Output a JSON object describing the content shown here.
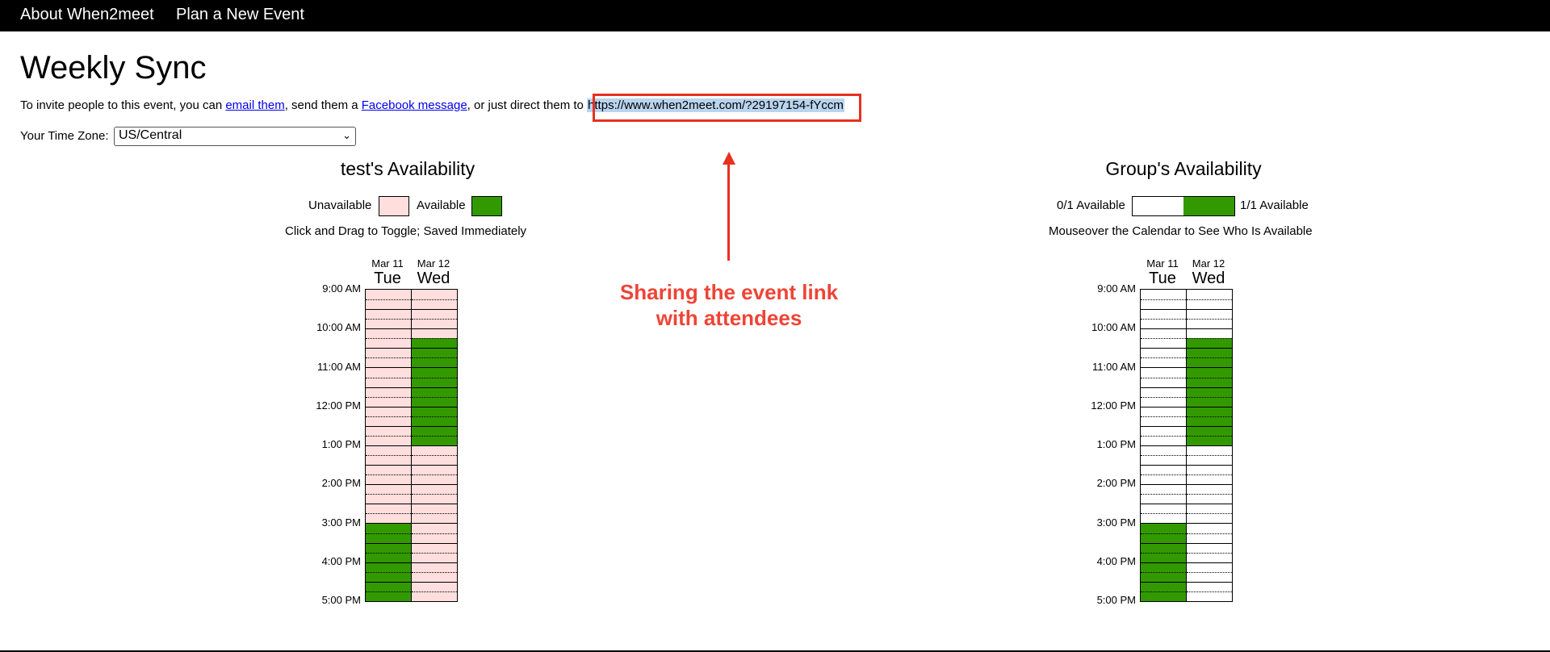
{
  "nav": {
    "about": "About When2meet",
    "plan": "Plan a New Event"
  },
  "event": {
    "title": "Weekly Sync"
  },
  "invite": {
    "prefix": "To invite people to this event, you can ",
    "email_link": "email them",
    "middle": ", send them a ",
    "fb_link": "Facebook message",
    "suffix": ", or just direct them to ",
    "url": "https://www.when2meet.com/?29197154-fYccm"
  },
  "timezone": {
    "label": "Your Time Zone:",
    "value": "US/Central"
  },
  "annotation": {
    "line1": "Sharing the event link",
    "line2": "with attendees"
  },
  "colors": {
    "unavailable": "#ffdede",
    "available": "#339900",
    "annotation": "#e8301f",
    "url_highlight": "#b9d4ee"
  },
  "personal": {
    "heading": "test's Availability",
    "legend_unavailable": "Unavailable",
    "legend_available": "Available",
    "hint": "Click and Drag to Toggle; Saved Immediately"
  },
  "group": {
    "heading": "Group's Availability",
    "legend_left": "0/1 Available",
    "legend_right": "1/1 Available",
    "hint": "Mouseover the Calendar to See Who Is Available"
  },
  "days": [
    {
      "date": "Mar 11",
      "name": "Tue"
    },
    {
      "date": "Mar 12",
      "name": "Wed"
    }
  ],
  "times": [
    "9:00 AM",
    "10:00 AM",
    "11:00 AM",
    "12:00 PM",
    "1:00 PM",
    "2:00 PM",
    "3:00 PM",
    "4:00 PM",
    "5:00 PM"
  ],
  "slot_labels": [
    "9:00",
    "9:15",
    "9:30",
    "9:45",
    "10:00",
    "10:15",
    "10:30",
    "10:45",
    "11:00",
    "11:15",
    "11:30",
    "11:45",
    "12:00",
    "12:15",
    "12:30",
    "12:45",
    "1:00",
    "1:15",
    "1:30",
    "1:45",
    "2:00",
    "2:15",
    "2:30",
    "2:45",
    "3:00",
    "3:15",
    "3:30",
    "3:45",
    "4:00",
    "4:15",
    "4:30",
    "4:45"
  ],
  "availability": {
    "tue": [
      0,
      0,
      0,
      0,
      0,
      0,
      0,
      0,
      0,
      0,
      0,
      0,
      0,
      0,
      0,
      0,
      0,
      0,
      0,
      0,
      0,
      0,
      0,
      0,
      1,
      1,
      1,
      1,
      1,
      1,
      1,
      1
    ],
    "wed": [
      0,
      0,
      0,
      0,
      0,
      1,
      1,
      1,
      1,
      1,
      1,
      1,
      1,
      1,
      1,
      1,
      0,
      0,
      0,
      0,
      0,
      0,
      0,
      0,
      0,
      0,
      0,
      0,
      0,
      0,
      0,
      0
    ]
  }
}
